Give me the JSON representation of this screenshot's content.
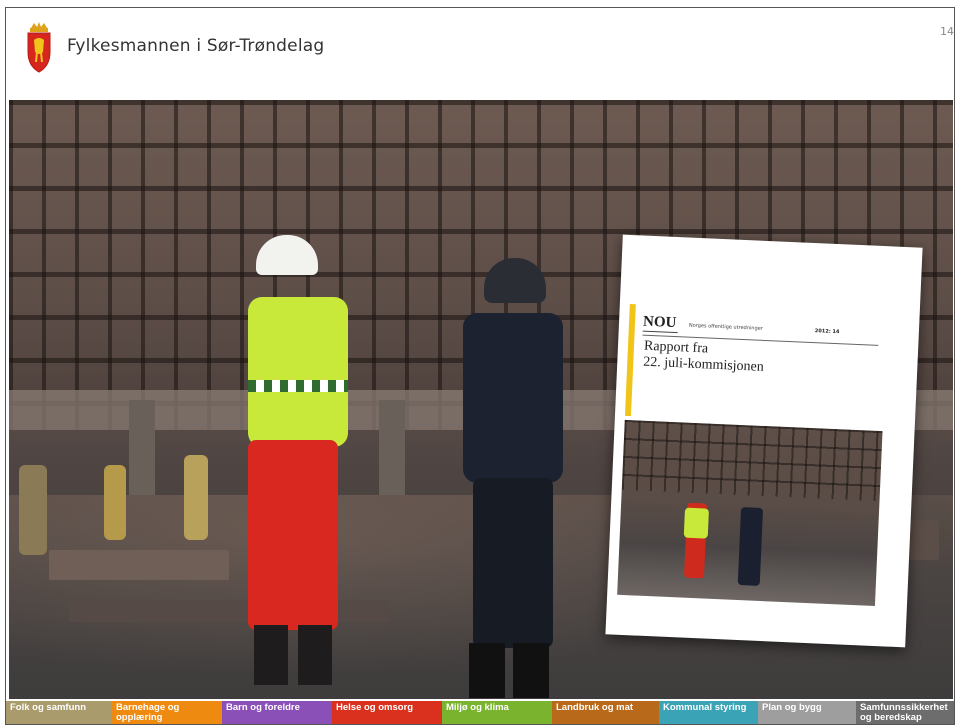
{
  "header": {
    "organization": "Fylkesmannen i Sør-Trøndelag",
    "page_number": "14",
    "logo_icon": "coat-of-arms-icon"
  },
  "photo": {
    "description_icon": "photo-image"
  },
  "report_cover": {
    "series": "NOU",
    "series_sub": "Norges offentlige utredninger",
    "year": "2012: 14",
    "title_line1": "Rapport fra",
    "title_line2": "22. juli-kommisjonen",
    "accent_color": "#f0c419"
  },
  "nav": {
    "items": [
      {
        "label": "Folk og samfunn",
        "color": "#a99b6b"
      },
      {
        "label": "Barnehage og opplæring",
        "color": "#ef8a10"
      },
      {
        "label": "Barn og foreldre",
        "color": "#8b4fb8"
      },
      {
        "label": "Helse og omsorg",
        "color": "#d9311e"
      },
      {
        "label": "Miljø og klima",
        "color": "#7ab42f"
      },
      {
        "label": "Landbruk og mat",
        "color": "#b86a1a"
      },
      {
        "label": "Kommunal styring",
        "color": "#3aa3b5"
      },
      {
        "label": "Plan og bygg",
        "color": "#9e9e9e"
      },
      {
        "label": "Samfunnssikkerhet og beredskap",
        "color": "#6d6d6d"
      }
    ]
  }
}
